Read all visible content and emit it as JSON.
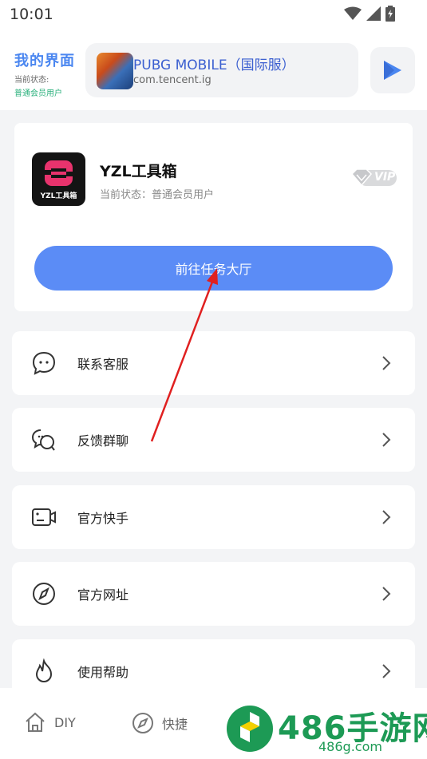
{
  "status_bar": {
    "time": "10:01"
  },
  "header": {
    "title": "我的界面",
    "status_label": "当前状态:",
    "status_value": "普通会员用户",
    "app": {
      "name": "PUBG MOBILE（国际服）",
      "package": "com.tencent.ig"
    }
  },
  "user_card": {
    "avatar_text": "YZL工具箱",
    "name": "YZL工具箱",
    "status": "当前状态：普通会员用户",
    "vip_label": "VIP",
    "task_button": "前往任务大厅"
  },
  "menu": {
    "items": [
      {
        "label": "联系客服",
        "icon": "chat-bubble-icon"
      },
      {
        "label": "反馈群聊",
        "icon": "group-chat-icon"
      },
      {
        "label": "官方快手",
        "icon": "video-camera-icon"
      },
      {
        "label": "官方网址",
        "icon": "compass-icon"
      },
      {
        "label": "使用帮助",
        "icon": "flame-icon"
      }
    ]
  },
  "bottom_nav": {
    "items": [
      {
        "label": "DIY",
        "icon": "home-icon"
      },
      {
        "label": "快捷",
        "icon": "compass-icon"
      }
    ]
  },
  "watermark": {
    "title": "486手游网",
    "url": "486g.com"
  },
  "colors": {
    "accent": "#5b8cf6",
    "title_blue": "#4a86f0",
    "status_green": "#2ab07c",
    "watermark_green": "#1d9a55",
    "arrow_red": "#e02020"
  }
}
